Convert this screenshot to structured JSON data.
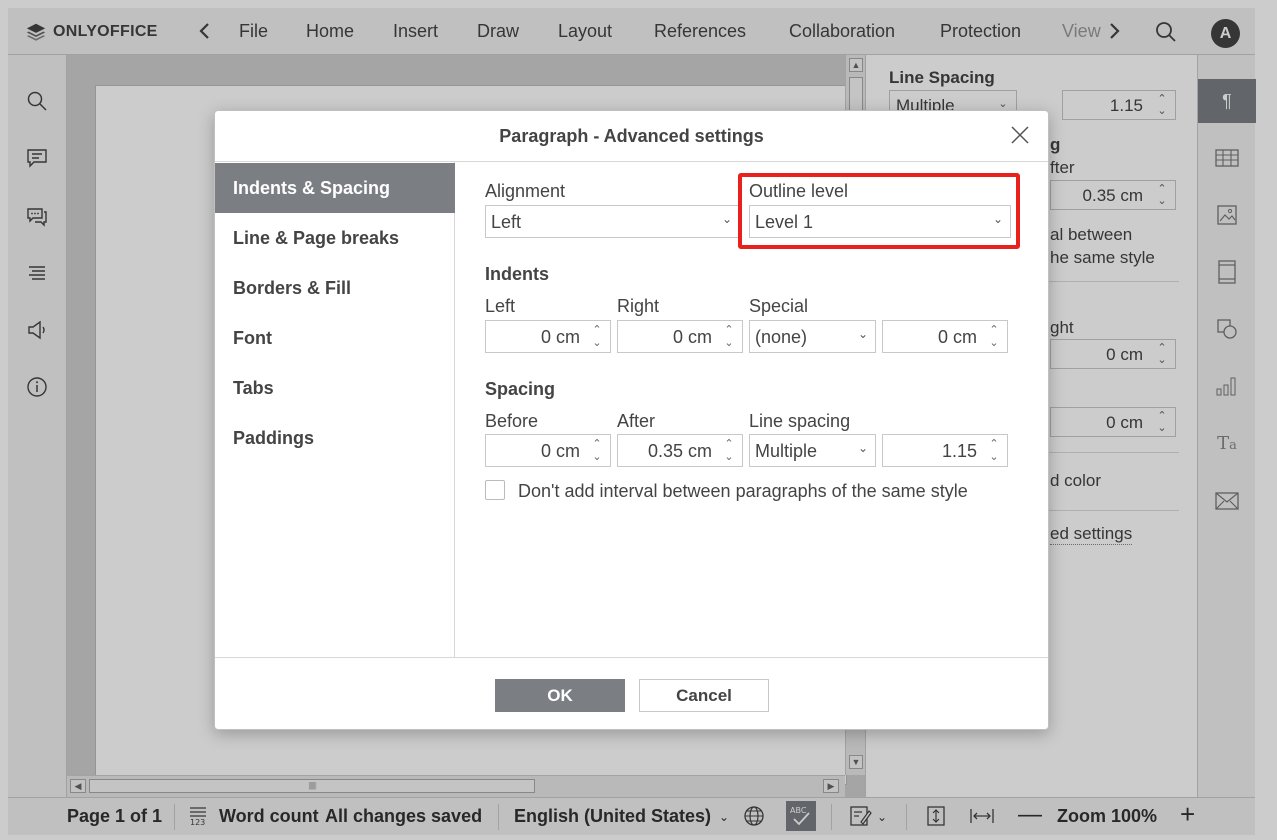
{
  "app": {
    "brand": "ONLYOFFICE"
  },
  "toolbar": {
    "tabs": [
      "File",
      "Home",
      "Insert",
      "Draw",
      "Layout",
      "References",
      "Collaboration",
      "Protection",
      "View"
    ],
    "avatar_initial": "A"
  },
  "left_sidebar": {
    "icons": [
      "search-icon",
      "comments-icon",
      "chat-icon",
      "navigation-icon",
      "feedback-icon",
      "about-icon"
    ]
  },
  "right_panel": {
    "line_spacing_title": "Line Spacing",
    "line_spacing_type": "Multiple",
    "line_spacing_value": "1.15",
    "spacing_partial": "g",
    "after_partial": "fter",
    "after_value": "0.35 cm",
    "interval_partial_1": "al between",
    "interval_partial_2": "he same style",
    "right_partial": "ght",
    "right_value": "0 cm",
    "special_value": "0 cm",
    "bg_color_partial": "d color",
    "advanced_partial": "ed settings"
  },
  "right_bar": {
    "icons": [
      "paragraph-icon",
      "table-icon",
      "image-icon",
      "header-footer-icon",
      "shape-icon",
      "chart-icon",
      "text-art-icon",
      "mail-merge-icon"
    ]
  },
  "statusbar": {
    "page": "Page 1 of 1",
    "word_count": "Word count",
    "save_status": "All changes saved",
    "language": "English (United States)",
    "zoom": "Zoom 100%"
  },
  "dialog": {
    "title": "Paragraph - Advanced settings",
    "nav": [
      "Indents & Spacing",
      "Line & Page breaks",
      "Borders & Fill",
      "Font",
      "Tabs",
      "Paddings"
    ],
    "active_nav": "Indents & Spacing",
    "alignment_label": "Alignment",
    "alignment_value": "Left",
    "outline_label": "Outline level",
    "outline_value": "Level 1",
    "indents_title": "Indents",
    "left_label": "Left",
    "left_value": "0 cm",
    "right_label": "Right",
    "right_value": "0 cm",
    "special_label": "Special",
    "special_value": "(none)",
    "special_by_value": "0 cm",
    "spacing_title": "Spacing",
    "before_label": "Before",
    "before_value": "0 cm",
    "after_label": "After",
    "after_value": "0.35 cm",
    "line_spacing_label": "Line spacing",
    "line_spacing_type": "Multiple",
    "line_spacing_value": "1.15",
    "checkbox_label": "Don't add interval between paragraphs of the same style",
    "ok_label": "OK",
    "cancel_label": "Cancel",
    "highlight_color": "#e8211d"
  }
}
